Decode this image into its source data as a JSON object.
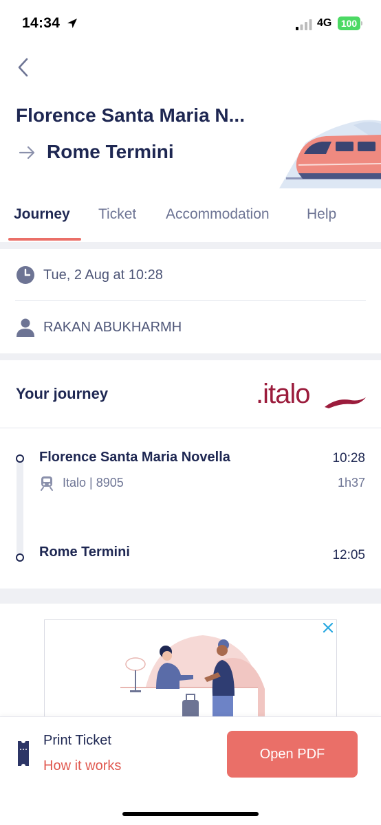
{
  "status_bar": {
    "time": "14:34",
    "network": "4G",
    "battery": "100",
    "colors": {
      "battery": "#4cd964"
    }
  },
  "header": {
    "from": "Florence Santa Maria N...",
    "to": "Rome Termini",
    "icons": {
      "back": "chevron-left-icon",
      "route": "arrow-right-icon",
      "art": "train-illustration"
    }
  },
  "tabs": [
    {
      "label": "Journey",
      "active": true
    },
    {
      "label": "Ticket",
      "active": false
    },
    {
      "label": "Accommodation",
      "active": false
    },
    {
      "label": "Help",
      "active": false
    }
  ],
  "details": {
    "datetime": "Tue, 2 Aug at 10:28",
    "passenger": "RAKAN ABUKHARMH"
  },
  "journey": {
    "title": "Your journey",
    "operator_logo": ".italo",
    "stops": [
      {
        "name": "Florence Santa Maria Novella",
        "time": "10:28"
      },
      {
        "name": "Rome Termini",
        "time": "12:05"
      }
    ],
    "train": "Italo | 8905",
    "duration": "1h37"
  },
  "bottom": {
    "print_title": "Print Ticket",
    "how_link": "How it works",
    "pdf_button": "Open PDF",
    "colors": {
      "accent": "#ea6f68",
      "link": "#e0584f",
      "navy": "#1e2752"
    }
  }
}
